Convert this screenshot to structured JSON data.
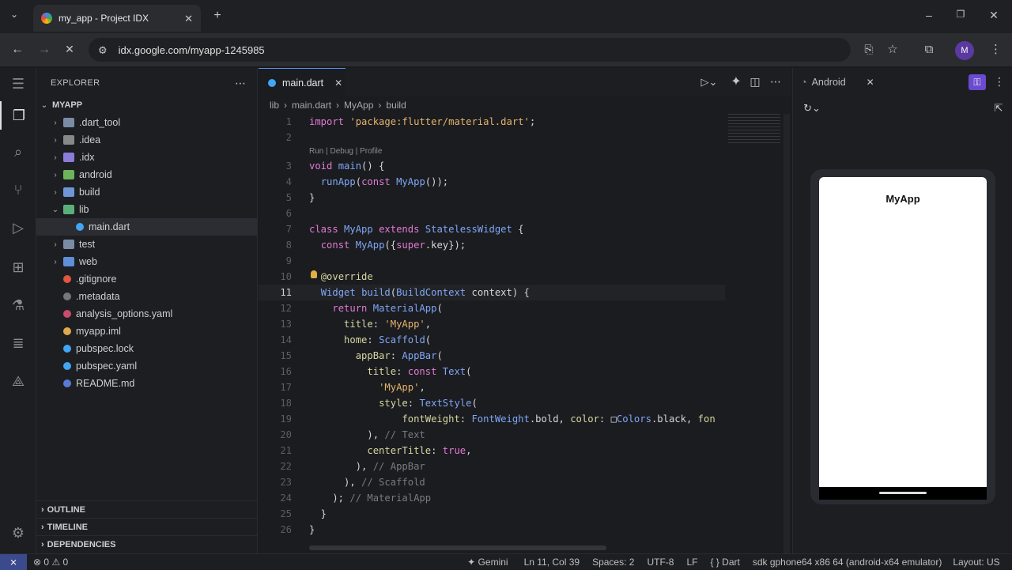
{
  "browser": {
    "tab_title": "my_app - Project IDX",
    "url": "idx.google.com/myapp-1245985",
    "profile_initial": "M",
    "colors": {
      "tab_bg": "#2b2c30",
      "chrome_bg": "#1f2023"
    }
  },
  "explorer": {
    "header": "EXPLORER",
    "root": "MYAPP",
    "items": [
      {
        "label": ".dart_tool",
        "type": "folder",
        "expanded": false,
        "depth": 1,
        "color": "#7a8ba6"
      },
      {
        "label": ".idea",
        "type": "folder",
        "expanded": false,
        "depth": 1,
        "color": "#888888"
      },
      {
        "label": ".idx",
        "type": "folder",
        "expanded": false,
        "depth": 1,
        "color": "#8a7cd8"
      },
      {
        "label": "android",
        "type": "folder",
        "expanded": false,
        "depth": 1,
        "color": "#6eb35a"
      },
      {
        "label": "build",
        "type": "folder",
        "expanded": false,
        "depth": 1,
        "color": "#6f95d6"
      },
      {
        "label": "lib",
        "type": "folder",
        "expanded": true,
        "depth": 1,
        "color": "#5bb07a"
      },
      {
        "label": "main.dart",
        "type": "file",
        "expanded": false,
        "depth": 2,
        "color": "#42a5f5"
      },
      {
        "label": "test",
        "type": "folder",
        "expanded": false,
        "depth": 1,
        "color": "#7a8ba6"
      },
      {
        "label": "web",
        "type": "folder",
        "expanded": false,
        "depth": 1,
        "color": "#5f8fd6"
      },
      {
        "label": ".gitignore",
        "type": "file",
        "expanded": false,
        "depth": 1,
        "color": "#e0573c"
      },
      {
        "label": ".metadata",
        "type": "file",
        "expanded": false,
        "depth": 1,
        "color": "#777777"
      },
      {
        "label": "analysis_options.yaml",
        "type": "file",
        "expanded": false,
        "depth": 1,
        "color": "#c94b6d"
      },
      {
        "label": "myapp.iml",
        "type": "file",
        "expanded": false,
        "depth": 1,
        "color": "#e0a94a"
      },
      {
        "label": "pubspec.lock",
        "type": "file",
        "expanded": false,
        "depth": 1,
        "color": "#42a5f5"
      },
      {
        "label": "pubspec.yaml",
        "type": "file",
        "expanded": false,
        "depth": 1,
        "color": "#42a5f5"
      },
      {
        "label": "README.md",
        "type": "file",
        "expanded": false,
        "depth": 1,
        "color": "#5a7ad8"
      }
    ],
    "panels": [
      "OUTLINE",
      "TIMELINE",
      "DEPENDENCIES"
    ]
  },
  "editor": {
    "tab_label": "main.dart",
    "breadcrumb": [
      "lib",
      "main.dart",
      "MyApp",
      "build"
    ],
    "codelens": "Run | Debug | Profile",
    "active_line": 11,
    "lines": [
      {
        "n": "1",
        "tokens": [
          [
            "kw",
            "import "
          ],
          [
            "st",
            "'package:flutter/material.dart'"
          ],
          [
            "tx",
            ";"
          ]
        ]
      },
      {
        "n": "2",
        "tokens": []
      },
      {
        "n": "3",
        "tokens": [
          [
            "kw",
            "void "
          ],
          [
            "ty",
            "main"
          ],
          [
            "tx",
            "() {"
          ]
        ]
      },
      {
        "n": "4",
        "tokens": [
          [
            "tx",
            "  "
          ],
          [
            "ty",
            "runApp"
          ],
          [
            "tx",
            "("
          ],
          [
            "kw",
            "const "
          ],
          [
            "ty",
            "MyApp"
          ],
          [
            "tx",
            "());"
          ]
        ]
      },
      {
        "n": "5",
        "tokens": [
          [
            "tx",
            "}"
          ]
        ]
      },
      {
        "n": "6",
        "tokens": []
      },
      {
        "n": "7",
        "tokens": [
          [
            "kw",
            "class "
          ],
          [
            "ty",
            "MyApp "
          ],
          [
            "kw",
            "extends "
          ],
          [
            "ty",
            "StatelessWidget "
          ],
          [
            "tx",
            "{"
          ]
        ]
      },
      {
        "n": "8",
        "tokens": [
          [
            "tx",
            "  "
          ],
          [
            "kw",
            "const "
          ],
          [
            "ty",
            "MyApp"
          ],
          [
            "tx",
            "({"
          ],
          [
            "kw",
            "super"
          ],
          [
            "tx",
            ".key});"
          ]
        ]
      },
      {
        "n": "9",
        "tokens": []
      },
      {
        "n": "10",
        "tokens": [
          [
            "tx",
            "  "
          ],
          [
            "pm",
            "@override"
          ]
        ]
      },
      {
        "n": "11",
        "tokens": [
          [
            "tx",
            "  "
          ],
          [
            "ty",
            "Widget "
          ],
          [
            "ty",
            "build"
          ],
          [
            "tx",
            "("
          ],
          [
            "ty",
            "BuildContext "
          ],
          [
            "tx",
            "context) {"
          ]
        ]
      },
      {
        "n": "12",
        "tokens": [
          [
            "tx",
            "    "
          ],
          [
            "kw",
            "return "
          ],
          [
            "ty",
            "MaterialApp"
          ],
          [
            "tx",
            "("
          ]
        ]
      },
      {
        "n": "13",
        "tokens": [
          [
            "tx",
            "      "
          ],
          [
            "pm",
            "title"
          ],
          [
            "tx",
            ": "
          ],
          [
            "st",
            "'MyApp'"
          ],
          [
            "tx",
            ","
          ]
        ]
      },
      {
        "n": "14",
        "tokens": [
          [
            "tx",
            "      "
          ],
          [
            "pm",
            "home"
          ],
          [
            "tx",
            ": "
          ],
          [
            "ty",
            "Scaffold"
          ],
          [
            "tx",
            "("
          ]
        ]
      },
      {
        "n": "15",
        "tokens": [
          [
            "tx",
            "        "
          ],
          [
            "pm",
            "appBar"
          ],
          [
            "tx",
            ": "
          ],
          [
            "ty",
            "AppBar"
          ],
          [
            "tx",
            "("
          ]
        ]
      },
      {
        "n": "16",
        "tokens": [
          [
            "tx",
            "          "
          ],
          [
            "pm",
            "title"
          ],
          [
            "tx",
            ": "
          ],
          [
            "kw",
            "const "
          ],
          [
            "ty",
            "Text"
          ],
          [
            "tx",
            "("
          ]
        ]
      },
      {
        "n": "17",
        "tokens": [
          [
            "tx",
            "            "
          ],
          [
            "st",
            "'MyApp'"
          ],
          [
            "tx",
            ","
          ]
        ]
      },
      {
        "n": "18",
        "tokens": [
          [
            "tx",
            "            "
          ],
          [
            "pm",
            "style"
          ],
          [
            "tx",
            ": "
          ],
          [
            "ty",
            "TextStyle"
          ],
          [
            "tx",
            "("
          ]
        ]
      },
      {
        "n": "19",
        "tokens": [
          [
            "tx",
            "                "
          ],
          [
            "pm",
            "fontWeight"
          ],
          [
            "tx",
            ": "
          ],
          [
            "ty",
            "FontWeight"
          ],
          [
            "tx",
            ".bold, "
          ],
          [
            "pm",
            "color"
          ],
          [
            "tx",
            ": □"
          ],
          [
            "ty",
            "Colors"
          ],
          [
            "tx",
            ".black, "
          ],
          [
            "pm",
            "fon"
          ]
        ]
      },
      {
        "n": "20",
        "tokens": [
          [
            "tx",
            "          ), "
          ],
          [
            "cm",
            "// Text"
          ]
        ]
      },
      {
        "n": "21",
        "tokens": [
          [
            "tx",
            "          "
          ],
          [
            "pm",
            "centerTitle"
          ],
          [
            "tx",
            ": "
          ],
          [
            "kw",
            "true"
          ],
          [
            "tx",
            ","
          ]
        ]
      },
      {
        "n": "22",
        "tokens": [
          [
            "tx",
            "        ), "
          ],
          [
            "cm",
            "// AppBar"
          ]
        ]
      },
      {
        "n": "23",
        "tokens": [
          [
            "tx",
            "      ), "
          ],
          [
            "cm",
            "// Scaffold"
          ]
        ]
      },
      {
        "n": "24",
        "tokens": [
          [
            "tx",
            "    ); "
          ],
          [
            "cm",
            "// MaterialApp"
          ]
        ]
      },
      {
        "n": "25",
        "tokens": [
          [
            "tx",
            "  }"
          ]
        ]
      },
      {
        "n": "26",
        "tokens": [
          [
            "tx",
            "}"
          ]
        ]
      }
    ]
  },
  "android_panel": {
    "tab_label": "Android",
    "app_title": "MyApp"
  },
  "statusbar": {
    "problems": "⊗ 0 ⚠ 0",
    "gemini": "✦ Gemini",
    "position": "Ln 11, Col 39",
    "spaces": "Spaces: 2",
    "encoding": "UTF-8",
    "eol": "LF",
    "language": "{ } Dart",
    "device": "sdk gphone64 x86 64 (android-x64 emulator)",
    "layout": "Layout: US"
  }
}
